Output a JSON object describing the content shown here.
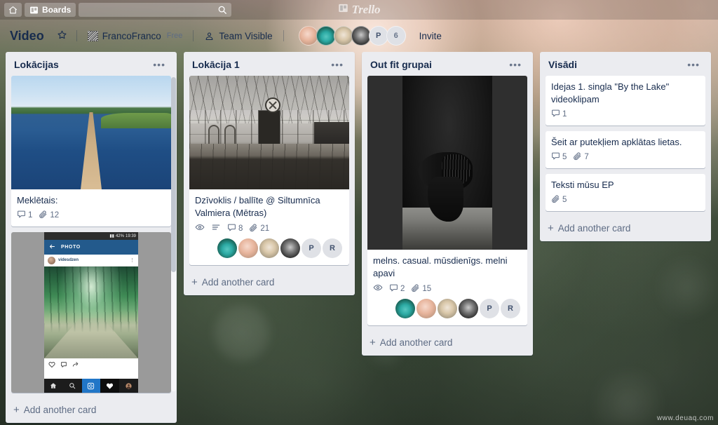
{
  "topbar": {
    "home_icon": "home-icon",
    "boards_label": "Boards",
    "boards_icon": "board-icon",
    "search_placeholder": "",
    "search_value": "",
    "search_icon": "search-icon",
    "logo_text": "Trello",
    "logo_icon": "trello-logo-icon"
  },
  "board_header": {
    "title": "Video",
    "star_icon": "star-icon",
    "team_name": "FrancoFranco",
    "plan_badge": "Free",
    "visibility_icon": "team-visible-icon",
    "visibility_label": "Team Visible",
    "member_overflow": "6",
    "member_initials": [
      "P"
    ],
    "invite_label": "Invite",
    "title_color": "#172b4d"
  },
  "lists": [
    {
      "title": "Lokācijas",
      "menu_icon": "list-menu-icon",
      "add_card_label": "Add another card",
      "has_scrollbar": true,
      "cards": [
        {
          "cover": "lake-pier-photo",
          "title": "Meklētais:",
          "badges": [
            {
              "icon": "comment-icon",
              "value": "1"
            },
            {
              "icon": "attachment-icon",
              "value": "12"
            }
          ],
          "members": []
        },
        {
          "cover": "instagram-photo-screenshot",
          "title": "",
          "badges": [],
          "members": [],
          "cover_detail": {
            "status_battery": "42%",
            "status_time": "19:39",
            "appbar_title": "PHOTO",
            "username": "videsdzen",
            "back_icon": "back-arrow-icon",
            "more_icon": "more-vertical-icon",
            "like_icon": "heart-icon",
            "comment_icon": "comment-icon",
            "share_icon": "share-icon",
            "tabs": [
              "home-icon",
              "search-icon",
              "camera-icon",
              "heart-icon",
              "profile-icon"
            ]
          }
        }
      ]
    },
    {
      "title": "Lokācija 1",
      "menu_icon": "list-menu-icon",
      "add_card_label": "Add another card",
      "has_scrollbar": false,
      "cards": [
        {
          "cover": "greenhouse-photo",
          "title": "Dzīvoklis / ballīte @ Siltumnīca Valmiera (Mētras)",
          "badges": [
            {
              "icon": "watch-eye-icon",
              "value": ""
            },
            {
              "icon": "description-icon",
              "value": ""
            },
            {
              "icon": "comment-icon",
              "value": "8"
            },
            {
              "icon": "attachment-icon",
              "value": "21"
            }
          ],
          "members": [
            "photo-teal",
            "photo-pink",
            "photo-blonde",
            "photo-dark",
            "P",
            "R"
          ]
        }
      ]
    },
    {
      "title": "Out fit grupai",
      "menu_icon": "list-menu-icon",
      "add_card_label": "Add another card",
      "has_scrollbar": false,
      "cards": [
        {
          "cover": "black-outfit-photo",
          "title": "melns. casual. mūsdienīgs. melni apavi",
          "badges": [
            {
              "icon": "watch-eye-icon",
              "value": ""
            },
            {
              "icon": "comment-icon",
              "value": "2"
            },
            {
              "icon": "attachment-icon",
              "value": "15"
            }
          ],
          "members": [
            "photo-teal",
            "photo-pink",
            "photo-blonde",
            "photo-dark",
            "P",
            "R"
          ]
        }
      ]
    },
    {
      "title": "Visādi",
      "menu_icon": "list-menu-icon",
      "add_card_label": "Add another card",
      "has_scrollbar": false,
      "cards": [
        {
          "cover": "",
          "title": "Idejas 1. singla \"By the Lake\" videoklipam",
          "badges": [
            {
              "icon": "comment-icon",
              "value": "1"
            }
          ],
          "members": []
        },
        {
          "cover": "",
          "title": "Šeit ar putekļiem apklātas lietas.",
          "badges": [
            {
              "icon": "comment-icon",
              "value": "5"
            },
            {
              "icon": "attachment-icon",
              "value": "7"
            }
          ],
          "members": []
        },
        {
          "cover": "",
          "title": "Teksti mūsu EP",
          "badges": [
            {
              "icon": "attachment-icon",
              "value": "5"
            }
          ],
          "members": []
        }
      ]
    }
  ],
  "watermark": "www.deuaq.com",
  "colors": {
    "list_bg": "#ebecf0",
    "card_bg": "#ffffff",
    "text_dark": "#172b4d",
    "text_muted": "#5e6c84",
    "avatar_bg": "#dfe1e6"
  }
}
